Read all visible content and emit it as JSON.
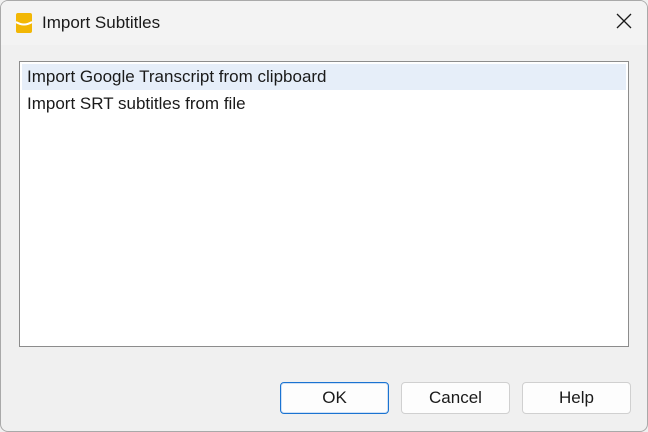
{
  "window": {
    "title": "Import Subtitles"
  },
  "icons": {
    "app": "app-logo-icon",
    "close": "close-icon"
  },
  "options": [
    {
      "label": "Import Google Transcript from clipboard",
      "selected": true
    },
    {
      "label": "Import SRT subtitles from file",
      "selected": false
    }
  ],
  "buttons": {
    "ok": "OK",
    "cancel": "Cancel",
    "help": "Help"
  },
  "colors": {
    "selection": "#e6eef9",
    "default_button_border": "#1a73d1",
    "app_icon": "#f2b705"
  }
}
